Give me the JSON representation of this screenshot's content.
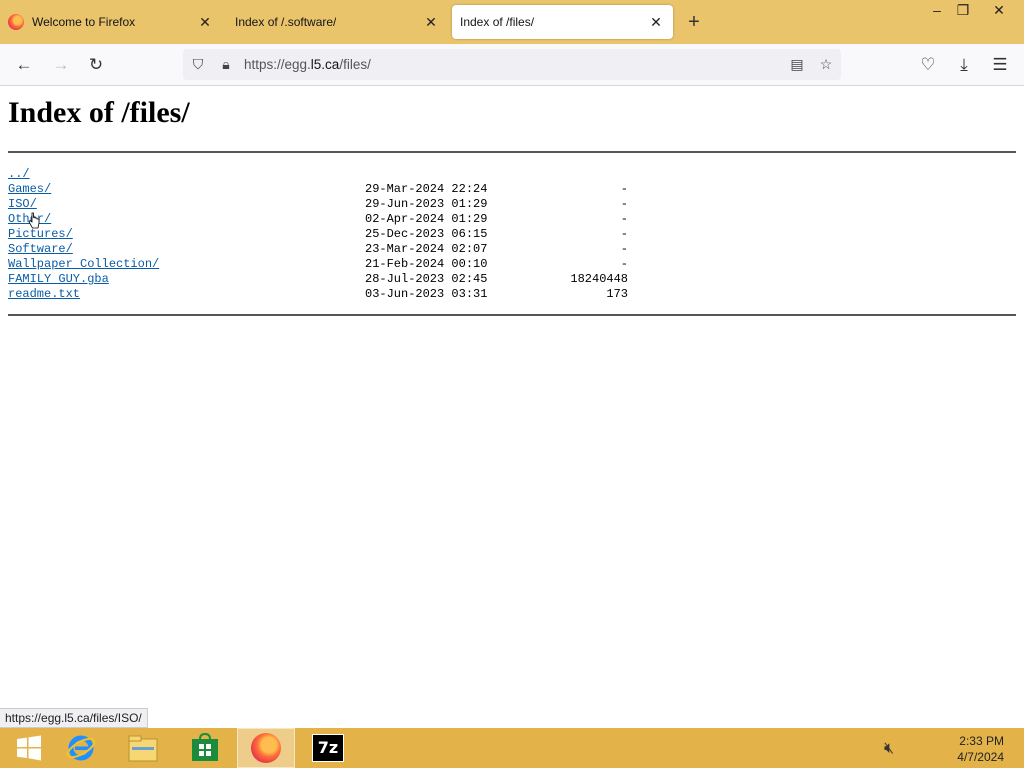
{
  "browser": {
    "tabs": [
      {
        "title": "Welcome to Firefox",
        "active": false
      },
      {
        "title": "Index of /.software/",
        "active": false
      },
      {
        "title": "Index of /files/",
        "active": true
      }
    ],
    "url_prefix": "https://egg.",
    "url_host": "l5.ca",
    "url_path": "/files/",
    "status_link": "https://egg.l5.ca/files/ISO/"
  },
  "page": {
    "heading": "Index of /files/",
    "entries": [
      {
        "name": "../",
        "date": "",
        "size": ""
      },
      {
        "name": "Games/",
        "date": "29-Mar-2024 22:24",
        "size": "-"
      },
      {
        "name": "ISO/",
        "date": "29-Jun-2023 01:29",
        "size": "-"
      },
      {
        "name": "Other/",
        "date": "02-Apr-2024 01:29",
        "size": "-"
      },
      {
        "name": "Pictures/",
        "date": "25-Dec-2023 06:15",
        "size": "-"
      },
      {
        "name": "Software/",
        "date": "23-Mar-2024 02:07",
        "size": "-"
      },
      {
        "name": "Wallpaper Collection/",
        "date": "21-Feb-2024 00:10",
        "size": "-"
      },
      {
        "name": "FAMILY GUY.gba",
        "date": "28-Jul-2023 02:45",
        "size": "18240448"
      },
      {
        "name": "readme.txt",
        "date": "03-Jun-2023 03:31",
        "size": "173"
      }
    ]
  },
  "taskbar": {
    "time": "2:33 PM",
    "date": "4/7/2024",
    "apps": [
      "start-icon",
      "internet-explorer-icon",
      "file-explorer-icon",
      "store-icon",
      "firefox-icon",
      "7zip-icon"
    ],
    "sevenzip_label": "7z"
  },
  "colors": {
    "tabstrip": "#e9c46a",
    "taskbar": "#e3b34a",
    "link": "#0b5ca8"
  }
}
